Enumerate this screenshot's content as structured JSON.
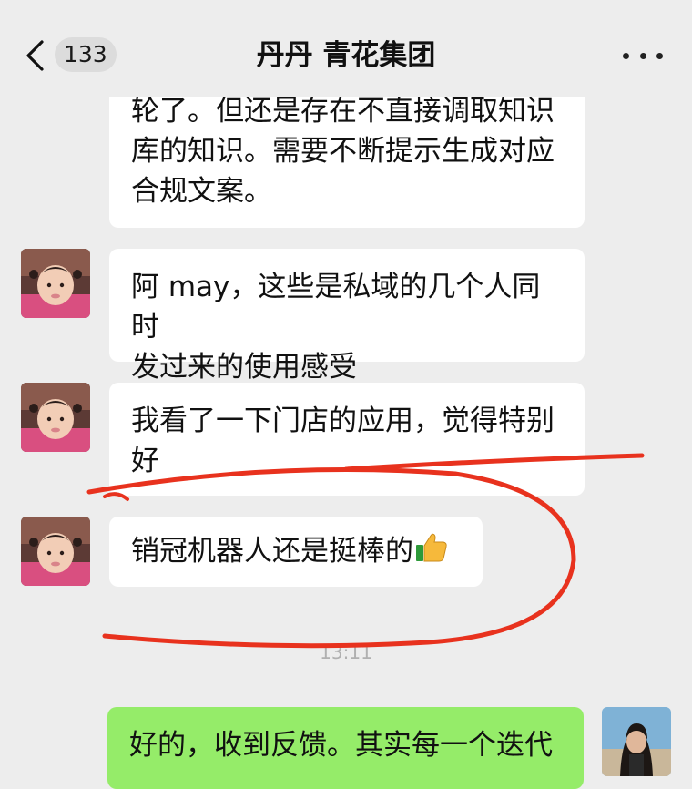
{
  "header": {
    "unread_count": "133",
    "title": "丹丹  青花集团"
  },
  "messages": [
    {
      "sender": "other",
      "text": "轮了。但还是存在不直接调取知识\n库的知识。需要不断提示生成对应\n合规文案。"
    },
    {
      "sender": "other",
      "text": "阿 may，这些是私域的几个人同时\n发过来的使用感受"
    },
    {
      "sender": "other",
      "text": "我看了一下门店的应用，觉得特别\n好"
    },
    {
      "sender": "other",
      "text": "销冠机器人还是挺棒的",
      "emoji": "thumbs-up-icon"
    },
    {
      "sender": "me",
      "text": "好的，收到反馈。其实每一个迭代"
    }
  ],
  "timestamp": "13:11",
  "colors": {
    "background": "#ededed",
    "bubble_other": "#ffffff",
    "bubble_mine": "#95ec69",
    "annotation_red": "#e8321e"
  }
}
